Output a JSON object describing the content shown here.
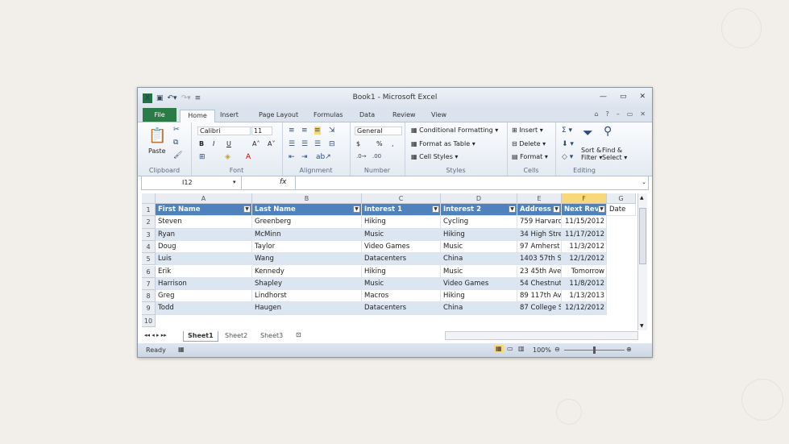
{
  "app": {
    "title": "Book1 - Microsoft Excel"
  },
  "ribbon_tabs": [
    "File",
    "Home",
    "Insert",
    "Page Layout",
    "Formulas",
    "Data",
    "Review",
    "View"
  ],
  "ribbon": {
    "clipboard": {
      "paste": "Paste",
      "label": "Clipboard"
    },
    "font": {
      "name": "Calibri",
      "size": "11",
      "label": "Font"
    },
    "alignment": {
      "label": "Alignment"
    },
    "number": {
      "format": "General",
      "label": "Number",
      "pct": "%",
      "comma": ",",
      "dollar": "$"
    },
    "styles": {
      "conditional": "Conditional Formatting",
      "format_table": "Format as Table",
      "cell_styles": "Cell Styles",
      "label": "Styles"
    },
    "cells": {
      "insert": "Insert",
      "delete": "Delete",
      "format": "Format",
      "label": "Cells"
    },
    "editing": {
      "sort_filter_1": "Sort &",
      "sort_filter_2": "Filter",
      "find_1": "Find &",
      "find_2": "Select",
      "label": "Editing"
    }
  },
  "formula_bar": {
    "name_box": "I12",
    "fx": "fx",
    "value": ""
  },
  "columns": [
    "A",
    "B",
    "C",
    "D",
    "E",
    "F",
    "G"
  ],
  "rows": [
    "1",
    "2",
    "3",
    "4",
    "5",
    "6",
    "7",
    "8",
    "9",
    "10"
  ],
  "table": {
    "headers": [
      "First Name",
      "Last Name",
      "Interest 1",
      "Interest 2",
      "Address",
      "Next Rev"
    ],
    "g1": "Date",
    "data": [
      [
        "Steven",
        "Greenberg",
        "Hiking",
        "Cycling",
        "759 Harvard",
        "11/15/2012"
      ],
      [
        "Ryan",
        "McMinn",
        "Music",
        "Hiking",
        "34 High Stre",
        "11/17/2012"
      ],
      [
        "Doug",
        "Taylor",
        "Video Games",
        "Music",
        "97 Amherst",
        "11/3/2012"
      ],
      [
        "Luis",
        "Wang",
        "Datacenters",
        "China",
        "1403 57th St",
        "12/1/2012"
      ],
      [
        "Erik",
        "Kennedy",
        "Hiking",
        "Music",
        "23 45th Ave",
        "Tomorrow"
      ],
      [
        "Harrison",
        "Shapley",
        "Music",
        "Video Games",
        "54 Chestnut",
        "11/8/2012"
      ],
      [
        "Greg",
        "Lindhorst",
        "Macros",
        "Hiking",
        "89 117th Av",
        "1/13/2013"
      ],
      [
        "Todd",
        "Haugen",
        "Datacenters",
        "China",
        "87 College S",
        "12/12/2012"
      ]
    ]
  },
  "sheets": [
    "Sheet1",
    "Sheet2",
    "Sheet3"
  ],
  "status": {
    "ready": "Ready",
    "zoom": "100%"
  },
  "colors": {
    "header_blue": "#4f81bd",
    "band": "#dce6f2",
    "file_green": "#2a7b46",
    "selected_col": "#f8d878"
  }
}
